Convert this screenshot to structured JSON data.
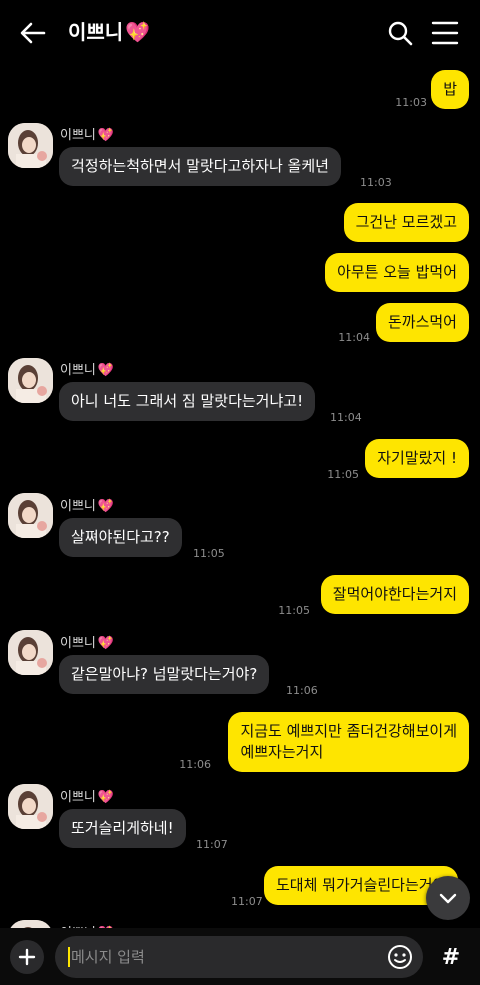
{
  "header": {
    "title": "이쁘니",
    "title_emoji": "💖",
    "back_icon": "arrow-left-icon",
    "search_icon": "search-icon",
    "menu_icon": "hamburger-menu-icon"
  },
  "contact": {
    "name": "이쁘니",
    "emoji": "💖"
  },
  "messages": [
    {
      "side": "out",
      "text": "밥",
      "time": "11:03"
    },
    {
      "side": "in",
      "text": "걱정하는척하면서 말랏다고하자나 올케년",
      "time": "11:03"
    },
    {
      "side": "out",
      "text": "그건난 모르겠고",
      "time": ""
    },
    {
      "side": "out",
      "text": "아무튼 오늘 밥먹어",
      "time": ""
    },
    {
      "side": "out",
      "text": "돈까스먹어",
      "time": "11:04"
    },
    {
      "side": "in",
      "text": "아니 너도 그래서 짐 말랏다는거냐고!",
      "time": "11:04"
    },
    {
      "side": "out",
      "text": "자기말랐지 !",
      "time": "11:05"
    },
    {
      "side": "in",
      "text": "살쪄야된다고??",
      "time": "11:05"
    },
    {
      "side": "out",
      "text": "잘먹어야한다는거지",
      "time": "11:05"
    },
    {
      "side": "in",
      "text": "같은말아냐? 넘말랏다는거야?",
      "time": "11:06"
    },
    {
      "side": "out",
      "text": "지금도 예쁘지만 좀더건강해보이게",
      "text2": "예쁘자는거지",
      "time": "11:06"
    },
    {
      "side": "in",
      "text": "또거슬리게하네!",
      "time": "11:07"
    },
    {
      "side": "out",
      "text": "도대체 뭐가거슬린다는거야",
      "time": "11:07"
    }
  ],
  "input": {
    "placeholder": "메시지 입력",
    "plus_icon": "plus-icon",
    "emoji_icon": "emoji-smile-icon",
    "hash_label": "#"
  },
  "scroll_button_icon": "chevron-down-icon",
  "colors": {
    "out_bubble": "#fee500",
    "in_bubble": "#2f2f31",
    "background": "#000000"
  }
}
